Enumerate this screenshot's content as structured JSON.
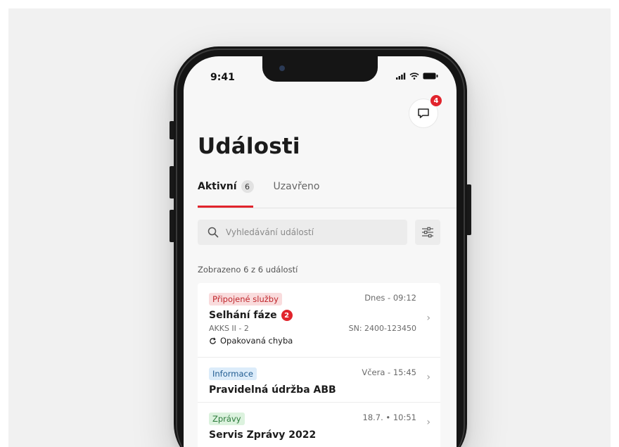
{
  "status_bar": {
    "time": "9:41"
  },
  "messages": {
    "badge_count": "4"
  },
  "page": {
    "title": "Události"
  },
  "tabs": [
    {
      "label": "Aktivní",
      "count": "6"
    },
    {
      "label": "Uzavřeno"
    }
  ],
  "search": {
    "placeholder": "Vyhledávání událostí"
  },
  "results": {
    "summary": "Zobrazeno 6 z 6 událostí"
  },
  "events": [
    {
      "tag": "Připojené služby",
      "tag_color": "#c0262c",
      "date": "Dnes - 09:12",
      "title": "Selhání fáze",
      "badge": "2",
      "device": "AKKS II - 2",
      "serial": "SN: 2400-123450",
      "note": "Opakovaná chyba"
    },
    {
      "tag": "Informace",
      "tag_color": "#205c91",
      "date": "Včera - 15:45",
      "title": "Pravidelná údržba ABB"
    },
    {
      "tag": "Zprávy",
      "tag_color": "#2b7a3a",
      "date": "18.7. • 10:51",
      "title": "Servis Zprávy 2022"
    }
  ],
  "colors": {
    "accent": "#e1242c",
    "screen_bg": "#f7f7f7"
  }
}
